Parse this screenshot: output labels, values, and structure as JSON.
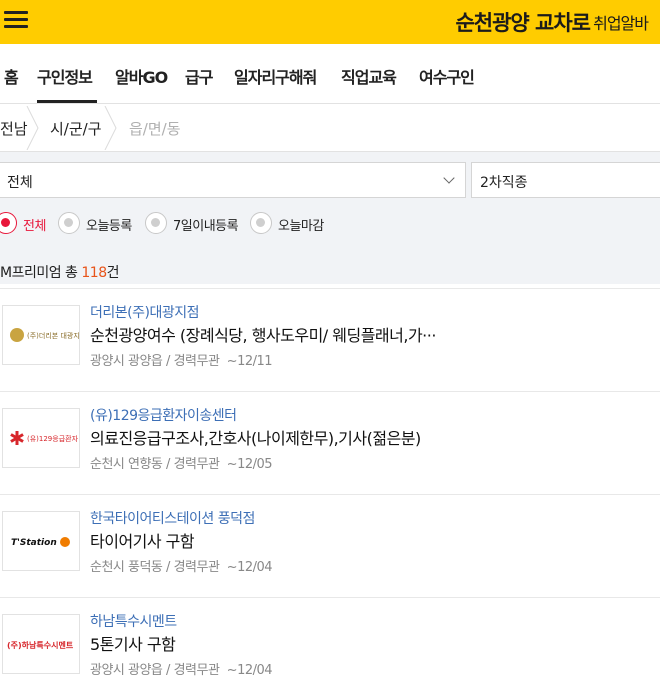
{
  "header": {
    "logo_main": "순천광양 교차로",
    "logo_sub": "취업알바",
    "brand_color": "#ffcc00"
  },
  "nav": {
    "tabs": [
      {
        "label": "홈"
      },
      {
        "label": "구인정보",
        "active": true
      },
      {
        "label": "알바GO"
      },
      {
        "label": "급구"
      },
      {
        "label": "일자리구해줘"
      },
      {
        "label": "직업교육"
      },
      {
        "label": "여수구인"
      }
    ]
  },
  "breadcrumb": {
    "items": [
      {
        "label": "전남"
      },
      {
        "label": "시/군/구"
      },
      {
        "label": "읍/면/동",
        "placeholder": true
      }
    ]
  },
  "filters": {
    "category_select": "전체",
    "subcategory_select": "2차직종",
    "radios": [
      {
        "label": "전체",
        "selected": true
      },
      {
        "label": "오늘등록"
      },
      {
        "label": "7일이내등록"
      },
      {
        "label": "오늘마감"
      }
    ],
    "accent_color": "#e8173b"
  },
  "summary": {
    "prefix": "M프리미엄 총 ",
    "count": "118",
    "suffix": "건"
  },
  "listings": [
    {
      "company": "더리본(주)대광지점",
      "title": "순천광양여수 (장례식당, 행사도우미/ 웨딩플래너,가···",
      "location": "광양시 광양읍",
      "career": "경력무관",
      "deadline": "~12/11",
      "logo_text": "(주)더리본 대광지점",
      "logo_icon": "gold-circle-emblem"
    },
    {
      "company": "(유)129응급환자이송센터",
      "title": "의료진응급구조사,간호사(나이제한무),기사(젊은분)",
      "location": "순천시 연향동",
      "career": "경력무관",
      "deadline": "~12/05",
      "logo_text": "(유)129응급환자 이송센터",
      "logo_icon": "red-star-of-life-icon"
    },
    {
      "company": "한국타이어티스테이션 풍덕점",
      "title": "타이어기사 구함",
      "location": "순천시 풍덕동",
      "career": "경력무관",
      "deadline": "~12/04",
      "logo_text": "T'Station",
      "logo_icon": "orange-t-badge-icon"
    },
    {
      "company": "하남특수시멘트",
      "title": "5톤기사 구함",
      "location": "광양시 광양읍",
      "career": "경력무관",
      "deadline": "~12/04",
      "logo_text": "(주)하남특수시멘트",
      "logo_icon": "text-logo"
    }
  ]
}
